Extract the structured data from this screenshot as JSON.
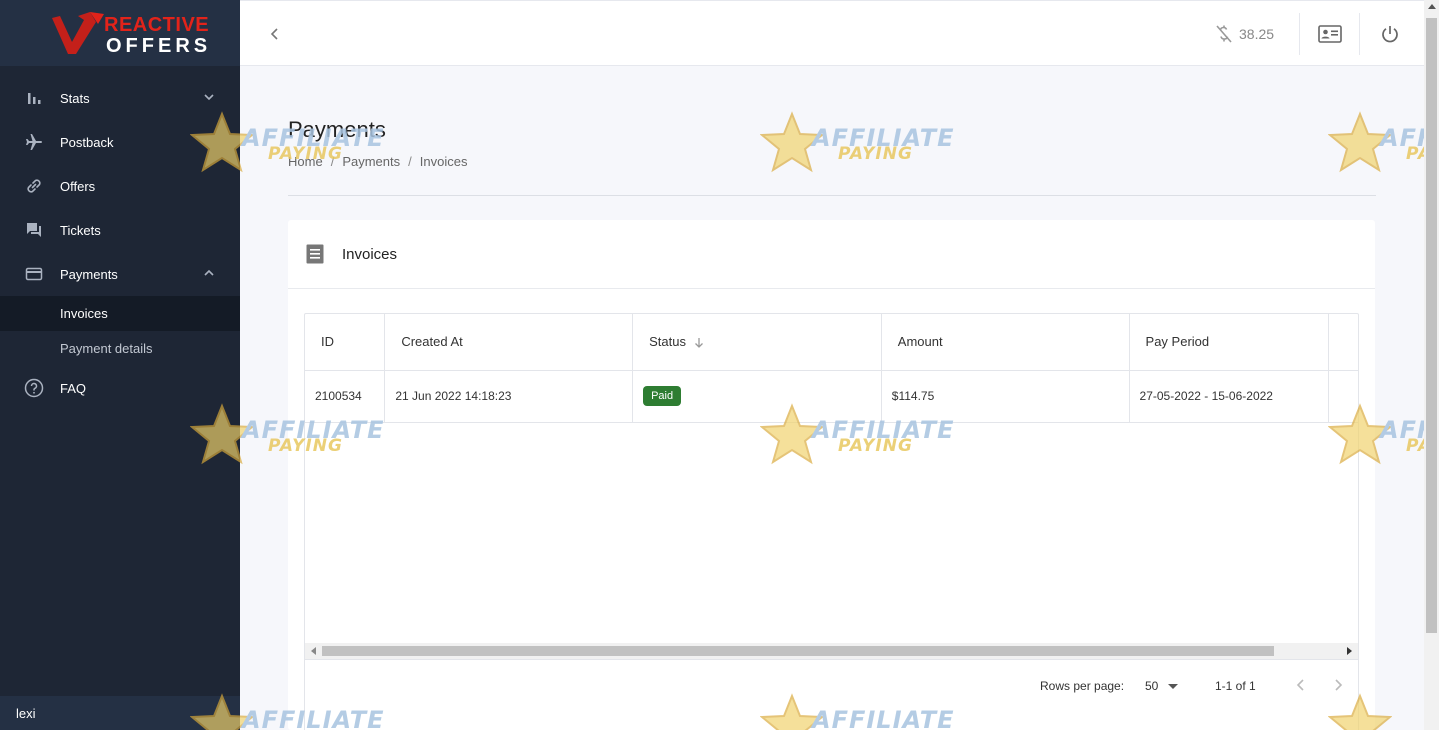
{
  "brand": {
    "line1": "REACTIVE",
    "line2": "OFFERS"
  },
  "sidebar": {
    "items": [
      {
        "label": "Stats",
        "icon": "bar-chart-icon"
      },
      {
        "label": "Postback",
        "icon": "airplane-icon"
      },
      {
        "label": "Offers",
        "icon": "link-icon"
      },
      {
        "label": "Tickets",
        "icon": "forum-icon"
      },
      {
        "label": "Payments",
        "icon": "credit-card-icon"
      },
      {
        "label": "FAQ",
        "icon": "help-circle-icon"
      }
    ],
    "payments_sub": [
      "Invoices",
      "Payment details"
    ],
    "user": "lexi"
  },
  "topbar": {
    "balance": "38.25"
  },
  "page": {
    "title": "Payments",
    "breadcrumb": [
      "Home",
      "Payments",
      "Invoices"
    ]
  },
  "card": {
    "title": "Invoices"
  },
  "table": {
    "headers": [
      "ID",
      "Created At",
      "Status",
      "Amount",
      "Pay Period"
    ],
    "rows": [
      {
        "id": "2100534",
        "created_at": "21 Jun 2022 14:18:23",
        "status": "Paid",
        "amount": "$114.75",
        "pay_period": "27-05-2022 - 15-06-2022"
      }
    ]
  },
  "pagination": {
    "rows_label": "Rows per page:",
    "rows_value": "50",
    "range": "1-1 of 1"
  },
  "watermark": {
    "line1": "AFFILIATE",
    "line2": "PAYING"
  },
  "colors": {
    "sidebar": "#1e2635",
    "status_paid": "#2e7d32",
    "brand_red": "#e2231a"
  }
}
